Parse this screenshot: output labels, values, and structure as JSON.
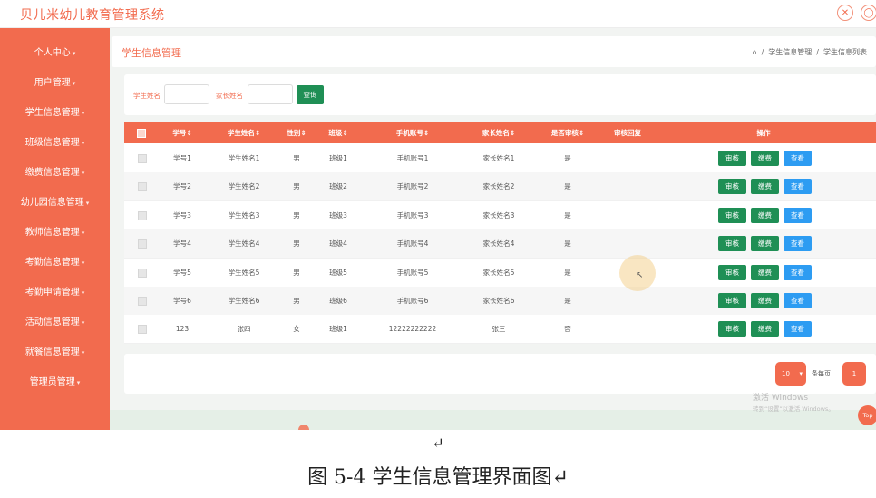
{
  "app": {
    "title": "贝儿米幼儿教育管理系统",
    "icons": [
      "fullscreen-icon",
      "user-icon"
    ]
  },
  "sidebar": {
    "items": [
      {
        "label": "个人中心"
      },
      {
        "label": "用户管理"
      },
      {
        "label": "学生信息管理"
      },
      {
        "label": "班级信息管理"
      },
      {
        "label": "缴费信息管理"
      },
      {
        "label": "幼儿园信息管理"
      },
      {
        "label": "教师信息管理"
      },
      {
        "label": "考勤信息管理"
      },
      {
        "label": "考勤申请管理"
      },
      {
        "label": "活动信息管理"
      },
      {
        "label": "就餐信息管理"
      },
      {
        "label": "管理员管理"
      }
    ]
  },
  "page": {
    "title": "学生信息管理",
    "breadcrumb": [
      "学生信息管理",
      "学生信息列表"
    ]
  },
  "search": {
    "name_label": "学生姓名",
    "name_value": "",
    "parent_label": "家长姓名",
    "parent_value": "",
    "button": "查询"
  },
  "table": {
    "columns": [
      "学号⇕",
      "学生姓名⇕",
      "性别⇕",
      "班级⇕",
      "手机账号⇕",
      "家长姓名⇕",
      "是否审核⇕",
      "审核回复",
      "操作"
    ],
    "actions": [
      "审核",
      "缴费",
      "查看"
    ],
    "rows": [
      {
        "id": "学号1",
        "name": "学生姓名1",
        "gender": "男",
        "class": "班级1",
        "phone": "手机账号1",
        "parent": "家长姓名1",
        "reviewed": "是",
        "reply": ""
      },
      {
        "id": "学号2",
        "name": "学生姓名2",
        "gender": "男",
        "class": "班级2",
        "phone": "手机账号2",
        "parent": "家长姓名2",
        "reviewed": "是",
        "reply": ""
      },
      {
        "id": "学号3",
        "name": "学生姓名3",
        "gender": "男",
        "class": "班级3",
        "phone": "手机账号3",
        "parent": "家长姓名3",
        "reviewed": "是",
        "reply": ""
      },
      {
        "id": "学号4",
        "name": "学生姓名4",
        "gender": "男",
        "class": "班级4",
        "phone": "手机账号4",
        "parent": "家长姓名4",
        "reviewed": "是",
        "reply": ""
      },
      {
        "id": "学号5",
        "name": "学生姓名5",
        "gender": "男",
        "class": "班级5",
        "phone": "手机账号5",
        "parent": "家长姓名5",
        "reviewed": "是",
        "reply": ""
      },
      {
        "id": "学号6",
        "name": "学生姓名6",
        "gender": "男",
        "class": "班级6",
        "phone": "手机账号6",
        "parent": "家长姓名6",
        "reviewed": "是",
        "reply": ""
      },
      {
        "id": "123",
        "name": "张四",
        "gender": "女",
        "class": "班级1",
        "phone": "12222222222",
        "parent": "张三",
        "reviewed": "否",
        "reply": ""
      }
    ]
  },
  "pagination": {
    "page_size": "10",
    "per_page_label": "条每页",
    "current_page": "1"
  },
  "watermark": {
    "line1": "激活 Windows",
    "line2": "转到“设置”以激活 Windows。"
  },
  "top_button": "Top",
  "caption": {
    "return_mark": "↵",
    "text": "图 5-4 学生信息管理界面图↵"
  },
  "colors": {
    "accent": "#f26b4e",
    "green": "#1f8f55",
    "blue": "#2d9cf2"
  }
}
